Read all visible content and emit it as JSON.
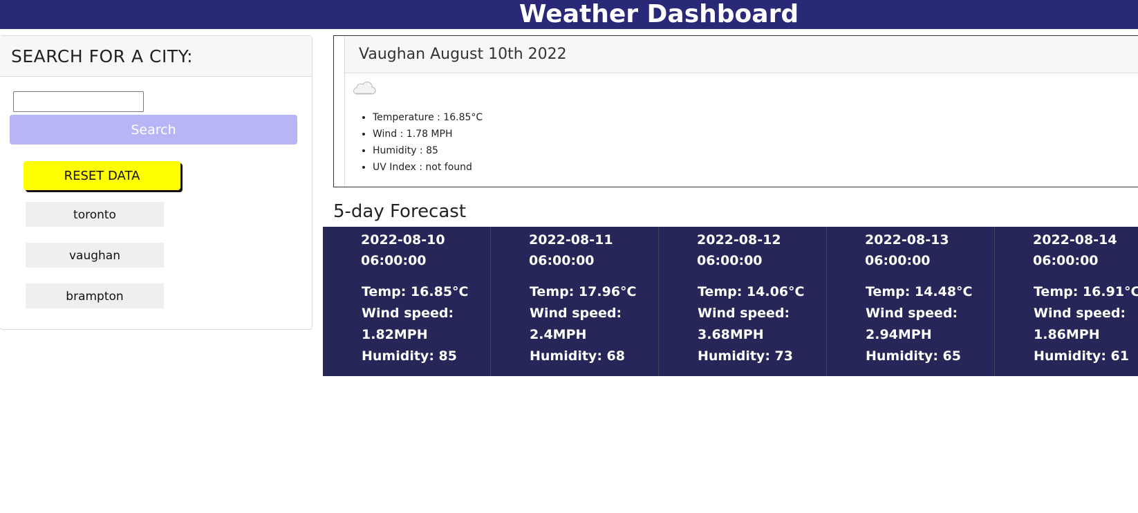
{
  "header": {
    "title": "Weather Dashboard"
  },
  "search": {
    "heading": "SEARCH FOR A CITY:",
    "input_value": "",
    "button_label": "Search",
    "reset_label": "RESET DATA",
    "history": [
      "toronto",
      "vaughan",
      "brampton"
    ]
  },
  "current": {
    "title": "Vaughan August 10th 2022",
    "icon": "cloud-icon",
    "temperature": "Temperature : 16.85°C",
    "wind": "Wind : 1.78 MPH",
    "humidity": "Humidity : 85",
    "uv": "UV Index : not found"
  },
  "forecast": {
    "title": "5-day Forecast",
    "days": [
      {
        "date": "2022-08-10",
        "time": "06:00:00",
        "temp": "Temp: 16.85°C",
        "wind_label": "Wind speed:",
        "wind": "1.82MPH",
        "humidity": "Humidity: 85"
      },
      {
        "date": "2022-08-11",
        "time": "06:00:00",
        "temp": "Temp: 17.96°C",
        "wind_label": "Wind speed:",
        "wind": "2.4MPH",
        "humidity": "Humidity: 68"
      },
      {
        "date": "2022-08-12",
        "time": "06:00:00",
        "temp": "Temp: 14.06°C",
        "wind_label": "Wind speed:",
        "wind": "3.68MPH",
        "humidity": "Humidity: 73"
      },
      {
        "date": "2022-08-13",
        "time": "06:00:00",
        "temp": "Temp: 14.48°C",
        "wind_label": "Wind speed:",
        "wind": "2.94MPH",
        "humidity": "Humidity: 65"
      },
      {
        "date": "2022-08-14",
        "time": "06:00:00",
        "temp": "Temp: 16.91°C",
        "wind_label": "Wind speed:",
        "wind": "1.86MPH",
        "humidity": "Humidity: 61"
      }
    ]
  },
  "colors": {
    "header_bg": "#292977",
    "search_button": "#b6b5f5",
    "reset_button": "#ffff00",
    "forecast_bg": "#272658"
  }
}
